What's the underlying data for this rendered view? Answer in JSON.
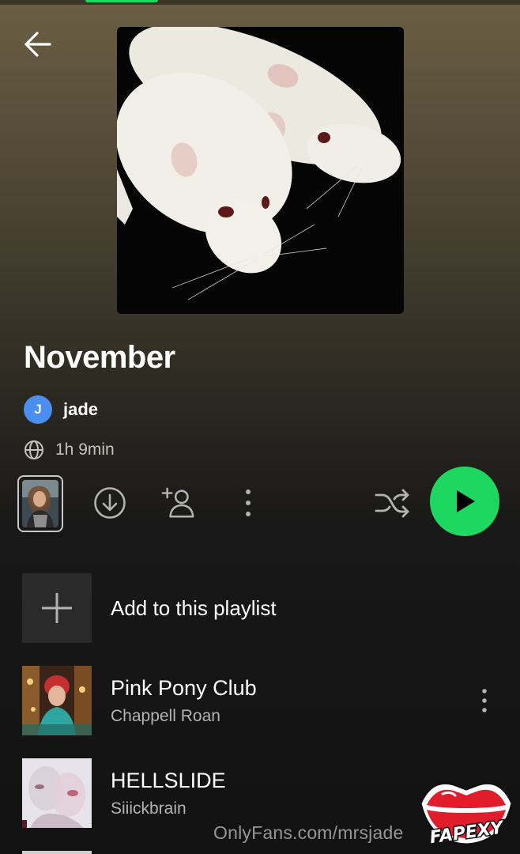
{
  "playlist": {
    "title": "November",
    "owner_initial": "J",
    "owner_name": "jade",
    "duration": "1h 9min"
  },
  "add_row": {
    "label": "Add to this playlist"
  },
  "tracks": [
    {
      "title": "Pink Pony Club",
      "artist": "Chappell Roan"
    },
    {
      "title": "HELLSLIDE",
      "artist": "Siiickbrain"
    }
  ],
  "overlay": {
    "watermark": "OnlyFans.com/mrsjade",
    "sticker_text": "FAPEXY"
  },
  "colors": {
    "accent_green": "#1ed760",
    "avatar_blue": "#4a8ff0",
    "background": "#121212"
  },
  "icons": [
    "back-arrow-icon",
    "globe-icon",
    "download-icon",
    "add-user-icon",
    "more-vertical-icon",
    "shuffle-icon",
    "play-icon",
    "plus-icon"
  ]
}
